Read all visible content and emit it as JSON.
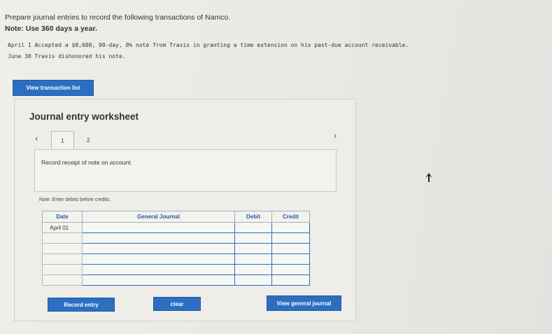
{
  "instructions": {
    "line1": "Prepare journal entries to record the following transactions of Namco.",
    "line2": "Note: Use 360 days a year."
  },
  "transactions": [
    {
      "date": "April 1",
      "text": "Accepted a $8,600, 90-day, 8% note from Travis in granting a time extension on his past-due account receivable."
    },
    {
      "date": "June 30",
      "text": "Travis dishonored his note."
    }
  ],
  "view_transaction_list_label": "View transaction list",
  "worksheet": {
    "title": "Journal entry worksheet",
    "tabs": [
      "1",
      "2"
    ],
    "description": "Record receipt of note on account.",
    "note": "Note: Enter debits before credits."
  },
  "table": {
    "headers": {
      "date": "Date",
      "general_journal": "General Journal",
      "debit": "Debit",
      "credit": "Credit"
    },
    "rows": [
      {
        "date": "April 01",
        "account": "",
        "debit": "",
        "credit": ""
      },
      {
        "date": "",
        "account": "",
        "debit": "",
        "credit": ""
      },
      {
        "date": "",
        "account": "",
        "debit": "",
        "credit": ""
      },
      {
        "date": "",
        "account": "",
        "debit": "",
        "credit": ""
      },
      {
        "date": "",
        "account": "",
        "debit": "",
        "credit": ""
      },
      {
        "date": "",
        "account": "",
        "debit": "",
        "credit": ""
      }
    ]
  },
  "buttons": {
    "record_entry": "Record entry",
    "clear": "clear",
    "view_general_journal": "View general journal"
  },
  "icons": {
    "prev": "chevron-left-icon",
    "next": "chevron-right-icon",
    "cursor": "mouse-pointer-icon"
  },
  "colors": {
    "accent": "#2c6fc0",
    "header_text": "#2a5aa0"
  }
}
